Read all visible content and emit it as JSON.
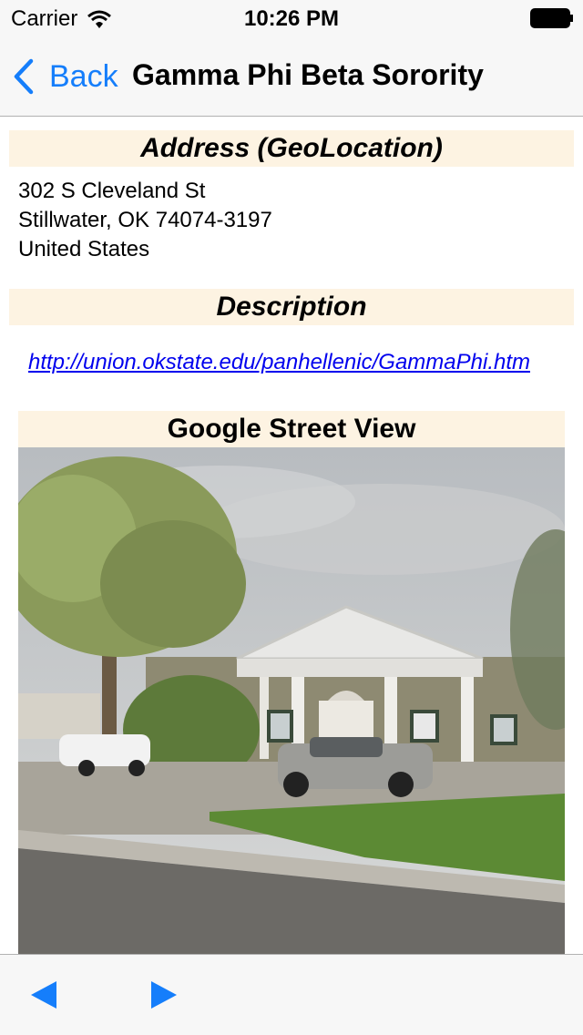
{
  "status_bar": {
    "carrier": "Carrier",
    "time": "10:26 PM"
  },
  "nav": {
    "back_label": "Back",
    "title": "Gamma Phi Beta Sorority",
    "accent_color": "#157efb"
  },
  "address": {
    "header": "Address (GeoLocation)",
    "lines": [
      "302 S Cleveland St",
      "Stillwater, OK 74074-3197",
      "United States"
    ]
  },
  "description": {
    "header": "Description",
    "link": "http://union.okstate.edu/panhellenic/GammaPhi.htm"
  },
  "street_view": {
    "header": "Google Street View"
  },
  "toolbar": {
    "prev_icon": "left-arrow-icon",
    "next_icon": "right-arrow-icon"
  }
}
